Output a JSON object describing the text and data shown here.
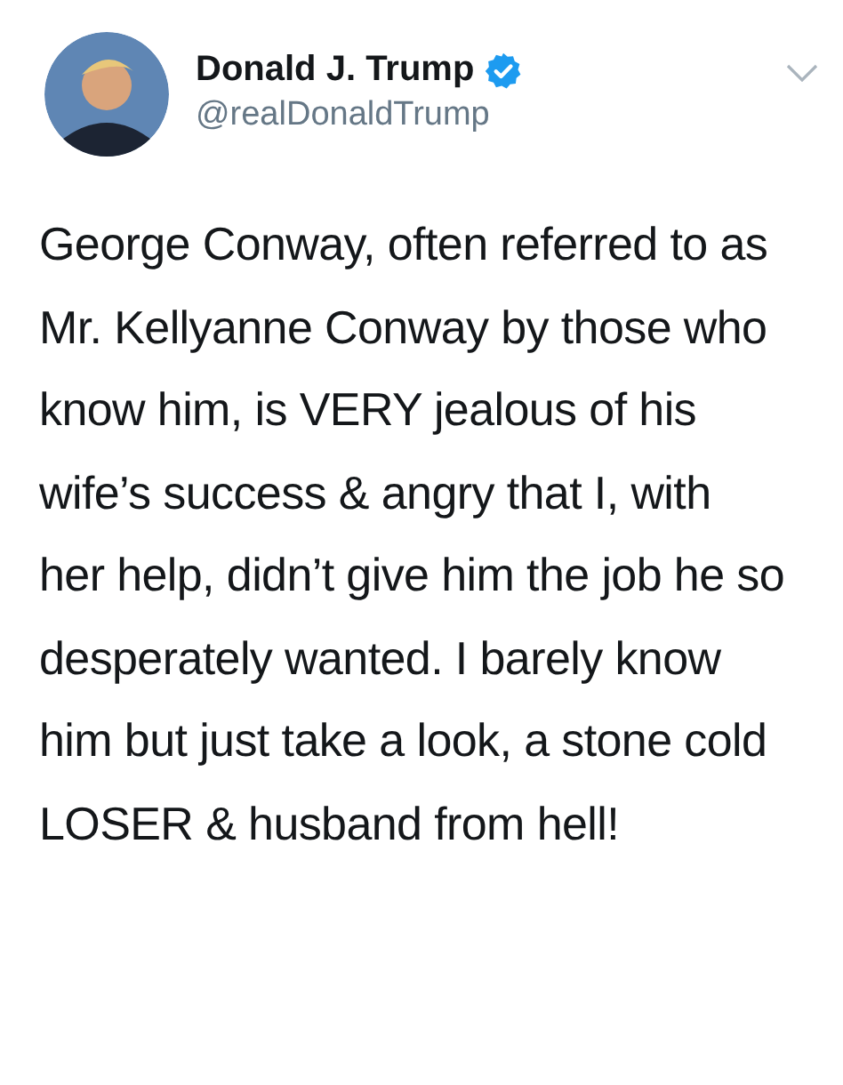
{
  "tweet": {
    "author": {
      "name": "Donald J. Trump",
      "verified": true,
      "handle": "@realDonaldTrump"
    },
    "text": "George Conway, often referred to as Mr. Kellyanne Conway by those who know him, is VERY jealous of his wife’s success & angry that I, with her help, didn’t give him the job he so desperately wanted. I barely know him but just take a look, a stone cold LOSER & husband from hell!"
  }
}
